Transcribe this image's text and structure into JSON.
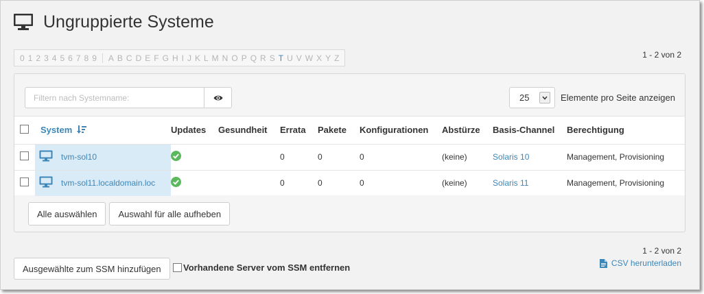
{
  "page": {
    "title": "Ungruppierte Systeme",
    "title_icon": "monitor-icon"
  },
  "alphabet": {
    "digits": [
      "0",
      "1",
      "2",
      "3",
      "4",
      "5",
      "6",
      "7",
      "8",
      "9"
    ],
    "letters": [
      "A",
      "B",
      "C",
      "D",
      "E",
      "F",
      "G",
      "H",
      "I",
      "J",
      "K",
      "L",
      "M",
      "N",
      "O",
      "P",
      "Q",
      "R",
      "S",
      "T",
      "U",
      "V",
      "W",
      "X",
      "Y",
      "Z"
    ],
    "active": [
      "T"
    ]
  },
  "pagination": {
    "top": "1 - 2 von 2",
    "bottom": "1 - 2 von 2"
  },
  "filter": {
    "placeholder": "Filtern nach Systemname:",
    "value": "",
    "button_icon": "eye-icon"
  },
  "per_page": {
    "value": "25",
    "label": "Elemente pro Seite anzeigen"
  },
  "table": {
    "columns": [
      "System",
      "Updates",
      "Gesundheit",
      "Errata",
      "Pakete",
      "Konfigurationen",
      "Abstürze",
      "Basis-Channel",
      "Berechtigung"
    ],
    "sort_icon": "sort-desc-icon",
    "rows": [
      {
        "system": "tvm-sol10",
        "updates": "check-icon",
        "gesundheit": "",
        "errata": "0",
        "pakete": "0",
        "konfigurationen": "0",
        "abstuerze": "(keine)",
        "channel": "Solaris 10",
        "berechtigung": "Management, Provisioning"
      },
      {
        "system": "tvm-sol11.localdomain.loc",
        "updates": "check-icon",
        "gesundheit": "",
        "errata": "0",
        "pakete": "0",
        "konfigurationen": "0",
        "abstuerze": "(keine)",
        "channel": "Solaris 11",
        "berechtigung": "Management, Provisioning"
      }
    ]
  },
  "buttons": {
    "select_all": "Alle auswählen",
    "unselect_all": "Auswahl für alle aufheben",
    "add_ssm": "Ausgewählte zum SSM hinzufügen",
    "remove_ssm": "Vorhandene Server vom SSM entfernen",
    "csv": "CSV herunterladen"
  },
  "colors": {
    "link": "#3c86b8",
    "ok_green": "#5cb85c",
    "selected_cell": "#d8ebf7"
  }
}
